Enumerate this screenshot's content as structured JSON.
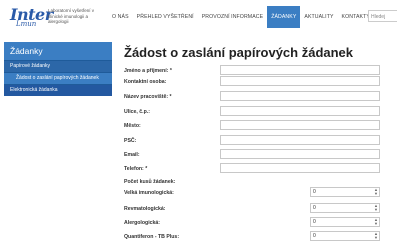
{
  "logo": {
    "word": "Inter",
    "sub": "Lmun"
  },
  "header": {
    "tagline": "Laboratorní vyšetření v klinické imunologii a alergologii"
  },
  "nav": {
    "items": [
      {
        "label": "O NÁS"
      },
      {
        "label": "PŘEHLED VYŠETŘENÍ"
      },
      {
        "label": "PROVOZNÍ INFORMACE"
      },
      {
        "label": "ŽÁDANKY"
      },
      {
        "label": "AKTUALITY"
      },
      {
        "label": "KONTAKTY"
      }
    ],
    "active": "ŽÁDANKY"
  },
  "search": {
    "placeholder": "Hledej"
  },
  "sidebar": {
    "title": "Žádanky",
    "items": [
      {
        "label": "Papírové žádanky"
      },
      {
        "label": "Žádost o zaslání papírových žádanek"
      },
      {
        "label": "Elektronická žádanka"
      }
    ]
  },
  "form": {
    "title": "Žádost o zaslání papírových žádanek",
    "fields": [
      {
        "label": "Jméno a příjmení: *",
        "value": ""
      },
      {
        "label": "Kontaktní osoba:",
        "value": ""
      },
      {
        "label": "Název pracoviště: *",
        "value": ""
      },
      {
        "label": "Ulice, č.p.:",
        "value": ""
      },
      {
        "label": "Město:",
        "value": ""
      },
      {
        "label": "PSČ:",
        "value": ""
      },
      {
        "label": "Email:",
        "value": ""
      },
      {
        "label": "Telefon: *",
        "value": ""
      }
    ],
    "count_heading": "Počet kusů žádanek:",
    "counts": [
      {
        "label": "Velká imunologická:",
        "value": "0"
      },
      {
        "label": "Revmatologická:",
        "value": "0"
      },
      {
        "label": "Alergologická:",
        "value": "0"
      },
      {
        "label": "Quantiferon - TB Plus:",
        "value": "0"
      }
    ]
  },
  "colors": {
    "accent": "#3b7ec3",
    "sidebar_dark": "#2358a0"
  }
}
